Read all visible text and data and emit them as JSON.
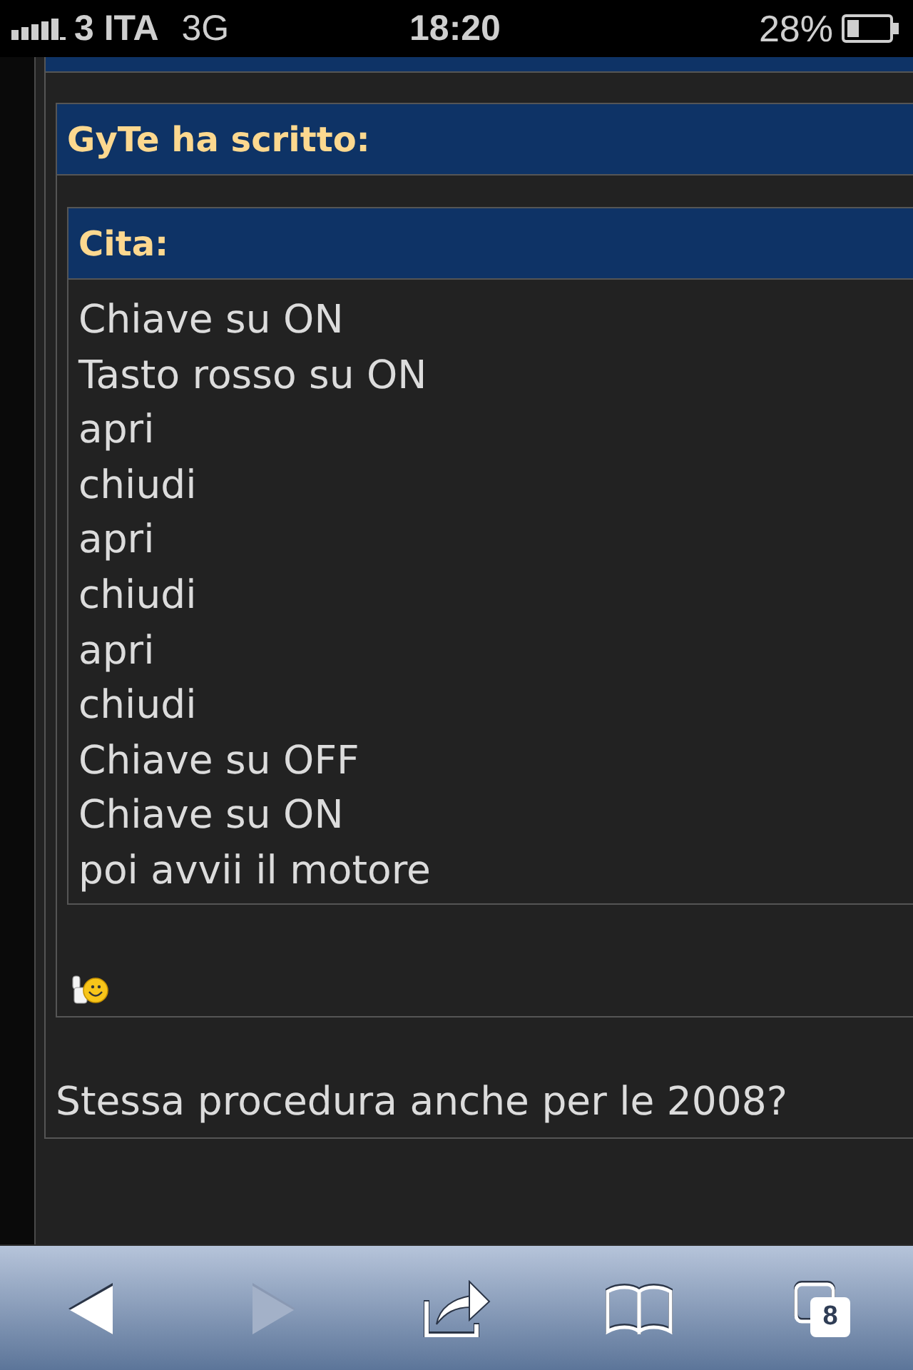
{
  "status_bar": {
    "carrier": "3 ITA",
    "network": "3G",
    "time": "18:20",
    "battery": "28%"
  },
  "post": {
    "quote": {
      "header": "GyTe ha scritto:",
      "inner_quote": {
        "header": "Cita:",
        "lines": [
          "Chiave su ON",
          "Tasto rosso su ON",
          "apri",
          "chiudi",
          "apri",
          "chiudi",
          "apri",
          "chiudi",
          "Chiave su OFF",
          "Chiave su ON",
          "poi avvii il motore"
        ]
      }
    },
    "reply": "Stessa procedura anche per le 2008?"
  },
  "toolbar": {
    "buttons": [
      {
        "kind": "back",
        "disabled": false
      },
      {
        "kind": "forward",
        "disabled": true
      },
      {
        "kind": "share",
        "disabled": false
      },
      {
        "kind": "bookmarks",
        "disabled": false
      },
      {
        "kind": "tabs",
        "disabled": false,
        "count": "8"
      }
    ]
  }
}
